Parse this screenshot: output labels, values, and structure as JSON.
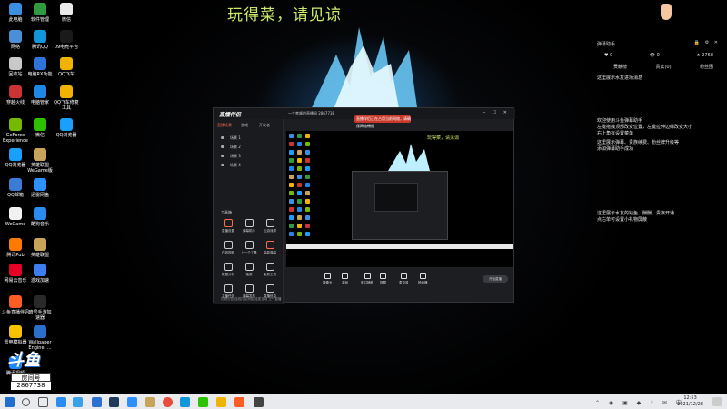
{
  "desktop": {
    "banner": "玩得菜，请见谅",
    "icons": [
      {
        "label": "此电脑",
        "color": "#3a8fe0"
      },
      {
        "label": "软件管理",
        "color": "#2f9a3f"
      },
      {
        "label": "微信",
        "color": "#eaeaea"
      },
      {
        "label": "网络",
        "color": "#4a90d9"
      },
      {
        "label": "腾讯QQ",
        "color": "#1296db"
      },
      {
        "label": "09电竞平台",
        "color": "#1a1a1a"
      },
      {
        "label": "回收站",
        "color": "#c9c9c9"
      },
      {
        "label": "电脑RX功能",
        "color": "#2f73d8"
      },
      {
        "label": "QQ飞车",
        "color": "#f0b400"
      },
      {
        "label": "穿越火线",
        "color": "#c33"
      },
      {
        "label": "电脑管家",
        "color": "#1e88e5"
      },
      {
        "label": "QQ飞车修复\n工具",
        "color": "#f0b400"
      },
      {
        "label": "GeForce\nExperience",
        "color": "#76b900"
      },
      {
        "label": "微信",
        "color": "#2dc100"
      },
      {
        "label": "QQ浏览器",
        "color": "#18a0fb"
      },
      {
        "label": "QQ浏览器",
        "color": "#18a0fb"
      },
      {
        "label": "英雄联盟\nWeGame版",
        "color": "#c8a45a"
      },
      {
        "label": "QQ邮箱",
        "color": "#3a7bd5"
      },
      {
        "label": "迅雷网盘",
        "color": "#2e8fff"
      },
      {
        "label": "WeGame",
        "color": "#f2f2f2"
      },
      {
        "label": "酷狗音乐",
        "color": "#2a8cf0"
      },
      {
        "label": "腾讯Pub",
        "color": "#ff7a00"
      },
      {
        "label": "英雄联盟",
        "color": "#c8a45a"
      },
      {
        "label": "网易云音乐",
        "color": "#e60026"
      },
      {
        "label": "游戏加速",
        "color": "#3d7df0"
      },
      {
        "label": "斗鱼直播伴侣",
        "color": "#ff5d23"
      },
      {
        "label": "暗号手游加\n速器",
        "color": "#2a2a2a"
      },
      {
        "label": "雷电模拟器",
        "color": "#f7c200"
      },
      {
        "label": "Wallpaper\nEngine: ...",
        "color": "#2a6fc9"
      },
      {
        "label": "腾讯视频",
        "color": "#1a8cff"
      }
    ],
    "room": {
      "big": "斗鱼",
      "label": "房间号",
      "number": "2867738"
    }
  },
  "right_panel": {
    "title": "弹幕助手",
    "window_controls": "🔒 ⚙ ✕",
    "stats": [
      "♥ 0",
      "👁 0",
      "★ 2768"
    ],
    "tabs": [
      "贡献榜",
      "贵宾(0)",
      "粉丝团"
    ],
    "lines": [
      "这里展示水友进场消息",
      "欢迎使用斗鱼弹幕助手",
      "左键拖拽顶部改变位置，左键拉伸边缘改变大小",
      "右上角有设置菜单",
      "这里展示弹幕、贵族续费、粉丝牌升级等",
      "添加弹幕助手成功",
      "这里展示水友的钱鱼、酬酬、贵族开通",
      "点右单可设置小礼物屏蔽"
    ]
  },
  "stream_window": {
    "logo": "直播伴侣",
    "tabs": [
      "直播场景",
      "游戏",
      "开发者"
    ],
    "stream_title": "一个孝顺的直播间 2867738",
    "red_notice": "直播伴侣正在占用当前网络，请确保网络畅通",
    "scenes": [
      "场景 1",
      "场景 2",
      "场景 3",
      "场景 4"
    ],
    "tools_title": "工具箱",
    "tools": [
      "直播设置",
      "弹幕助手",
      "云游戏屏",
      "在线视频",
      "上一个工具",
      "高能弹幕",
      "数据分析",
      "抽奖",
      "聚焦工具",
      "主播任务",
      "弹幕发布",
      "直播信息"
    ],
    "preview_banner": "玩得菜，请见谅",
    "bottom_tools": [
      "摄像头",
      "游戏",
      "窗口捕获",
      "投屏",
      "麦克风",
      "扬声器"
    ],
    "start_label": "开始直播",
    "footer": "礼物公告  连线打赏消息  连麦互动  上一直播"
  },
  "taskbar": {
    "time": "12:53",
    "date": "2021/12/28"
  }
}
